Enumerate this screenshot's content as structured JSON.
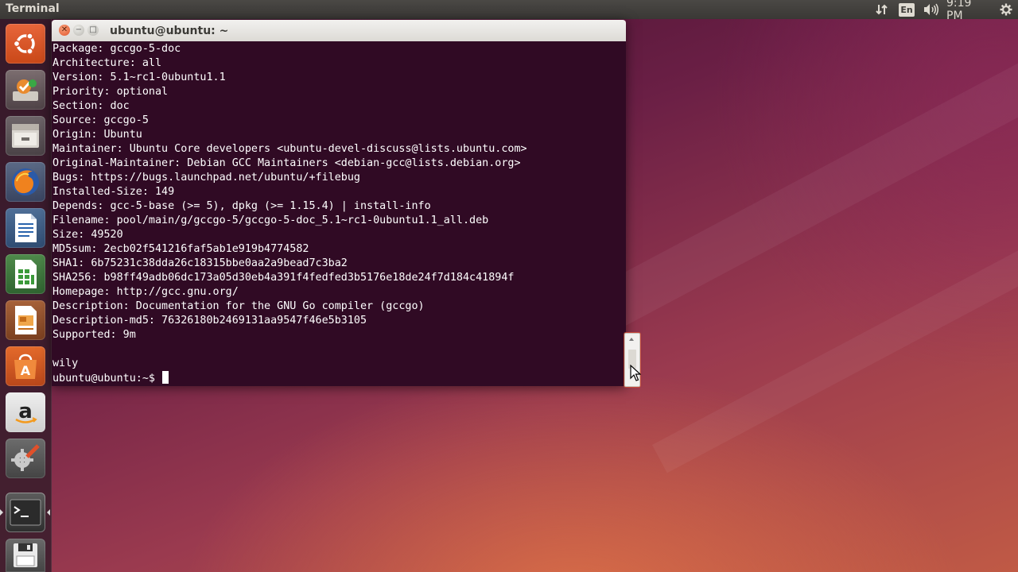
{
  "panel": {
    "app_title": "Terminal",
    "keyboard_layout": "En",
    "clock": "9:19 PM",
    "icons": [
      "network-updown-icon",
      "keyboard-layout-icon",
      "volume-icon",
      "gear-icon"
    ]
  },
  "launcher": {
    "items": [
      "ubuntu-dash-icon",
      "software-updater-icon",
      "file-manager-icon",
      "firefox-icon",
      "libreoffice-writer-icon",
      "libreoffice-calc-icon",
      "libreoffice-impress-icon",
      "ubuntu-software-center-icon",
      "amazon-icon",
      "system-settings-icon",
      "terminal-icon",
      "floppy-save-icon"
    ],
    "active_item": "terminal-icon"
  },
  "window": {
    "title": "ubuntu@ubuntu: ~",
    "buttons": [
      "close",
      "minimize",
      "maximize"
    ]
  },
  "terminal": {
    "lines": [
      "Package: gccgo-5-doc",
      "Architecture: all",
      "Version: 5.1~rc1-0ubuntu1.1",
      "Priority: optional",
      "Section: doc",
      "Source: gccgo-5",
      "Origin: Ubuntu",
      "Maintainer: Ubuntu Core developers <ubuntu-devel-discuss@lists.ubuntu.com>",
      "Original-Maintainer: Debian GCC Maintainers <debian-gcc@lists.debian.org>",
      "Bugs: https://bugs.launchpad.net/ubuntu/+filebug",
      "Installed-Size: 149",
      "Depends: gcc-5-base (>= 5), dpkg (>= 1.15.4) | install-info",
      "Filename: pool/main/g/gccgo-5/gccgo-5-doc_5.1~rc1-0ubuntu1.1_all.deb",
      "Size: 49520",
      "MD5sum: 2ecb02f541216faf5ab1e919b4774582",
      "SHA1: 6b75231c38dda26c18315bbe0aa2a9bead7c3ba2",
      "SHA256: b98ff49adb06dc173a05d30eb4a391f4fedfed3b5176e18de24f7d184c41894f",
      "Homepage: http://gcc.gnu.org/",
      "Description: Documentation for the GNU Go compiler (gccgo)",
      "Description-md5: 76326180b2469131aa9547f46e5b3105",
      "Supported: 9m",
      "",
      "wily"
    ],
    "prompt": "ubuntu@ubuntu:~$ "
  },
  "colors": {
    "terminal_bg": "#300a24",
    "terminal_fg": "#ffffff",
    "panel_bg": "#3c3b37",
    "close_button": "#e2542a"
  }
}
